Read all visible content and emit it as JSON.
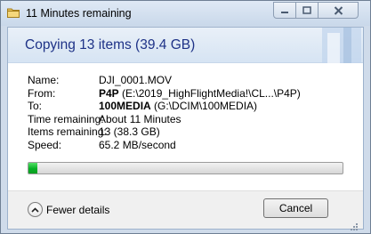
{
  "window": {
    "title": "11 Minutes remaining"
  },
  "header": {
    "title": "Copying 13 items (39.4 GB)"
  },
  "details": {
    "name_label": "Name:",
    "name_value": "DJI_0001.MOV",
    "from_label": "From:",
    "from_folder": "P4P",
    "from_path": "(E:\\2019_HighFlightMedia!\\CL...\\P4P)",
    "to_label": "To:",
    "to_folder": "100MEDIA",
    "to_path": "(G:\\DCIM\\100MEDIA)",
    "time_label": "Time remaining:",
    "time_value": "About 11 Minutes",
    "items_label": "Items remaining:",
    "items_value": "13 (38.3 GB)",
    "speed_label": "Speed:",
    "speed_value": "65.2 MB/second"
  },
  "progress": {
    "percent": 2.8,
    "color": "#06b025"
  },
  "footer": {
    "fewer_details_label": "Fewer details",
    "cancel_label": "Cancel"
  },
  "icons": {
    "app": "copy-folder-icon",
    "minimize": "minimize-icon",
    "maximize": "maximize-icon",
    "close": "close-icon",
    "fewer_details": "chevron-up-icon"
  }
}
